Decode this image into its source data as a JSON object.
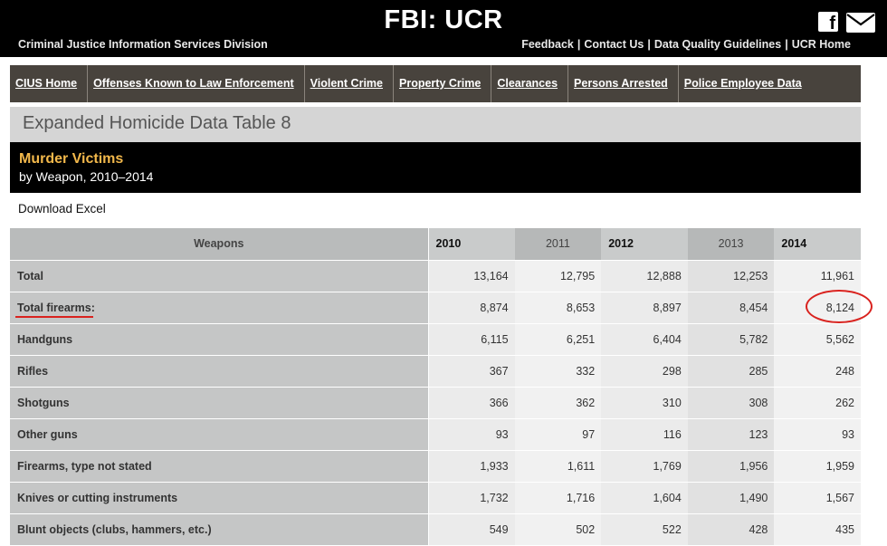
{
  "banner": {
    "title": "FBI: UCR",
    "subtitle_left": "Criminal Justice Information Services Division",
    "links_right": [
      "Feedback",
      "Contact Us",
      "Data Quality Guidelines",
      "UCR Home"
    ]
  },
  "icons": {
    "social": "facebook-icon",
    "email": "envelope-icon"
  },
  "nav": {
    "items": [
      "CIUS Home",
      "Offenses Known to Law Enforcement",
      "Violent Crime",
      "Property Crime",
      "Clearances",
      "Persons Arrested",
      "Police Employee Data"
    ]
  },
  "heading": "Expanded Homicide Data Table 8",
  "title": {
    "main": "Murder Victims",
    "sub": "by Weapon, 2010–2014"
  },
  "download_label": "Download Excel",
  "table": {
    "headers": [
      "Weapons",
      "2010",
      "2011",
      "2012",
      "2013",
      "2014"
    ],
    "rows": [
      {
        "label": "Total",
        "values": [
          "13,164",
          "12,795",
          "12,888",
          "12,253",
          "11,961"
        ]
      },
      {
        "label": "Total firearms:",
        "values": [
          "8,874",
          "8,653",
          "8,897",
          "8,454",
          "8,124"
        ]
      },
      {
        "label": "Handguns",
        "values": [
          "6,115",
          "6,251",
          "6,404",
          "5,782",
          "5,562"
        ]
      },
      {
        "label": "Rifles",
        "values": [
          "367",
          "332",
          "298",
          "285",
          "248"
        ]
      },
      {
        "label": "Shotguns",
        "values": [
          "366",
          "362",
          "310",
          "308",
          "262"
        ]
      },
      {
        "label": "Other guns",
        "values": [
          "93",
          "97",
          "116",
          "123",
          "93"
        ]
      },
      {
        "label": "Firearms, type not stated",
        "values": [
          "1,933",
          "1,611",
          "1,769",
          "1,956",
          "1,959"
        ]
      },
      {
        "label": "Knives or cutting instruments",
        "values": [
          "1,732",
          "1,716",
          "1,604",
          "1,490",
          "1,567"
        ]
      },
      {
        "label": "Blunt objects (clubs, hammers, etc.)",
        "values": [
          "549",
          "502",
          "522",
          "428",
          "435"
        ]
      }
    ]
  },
  "colors": {
    "annotation": "#d9221e",
    "title_accent": "#f2b84b",
    "nav_bg": "#48433d"
  }
}
